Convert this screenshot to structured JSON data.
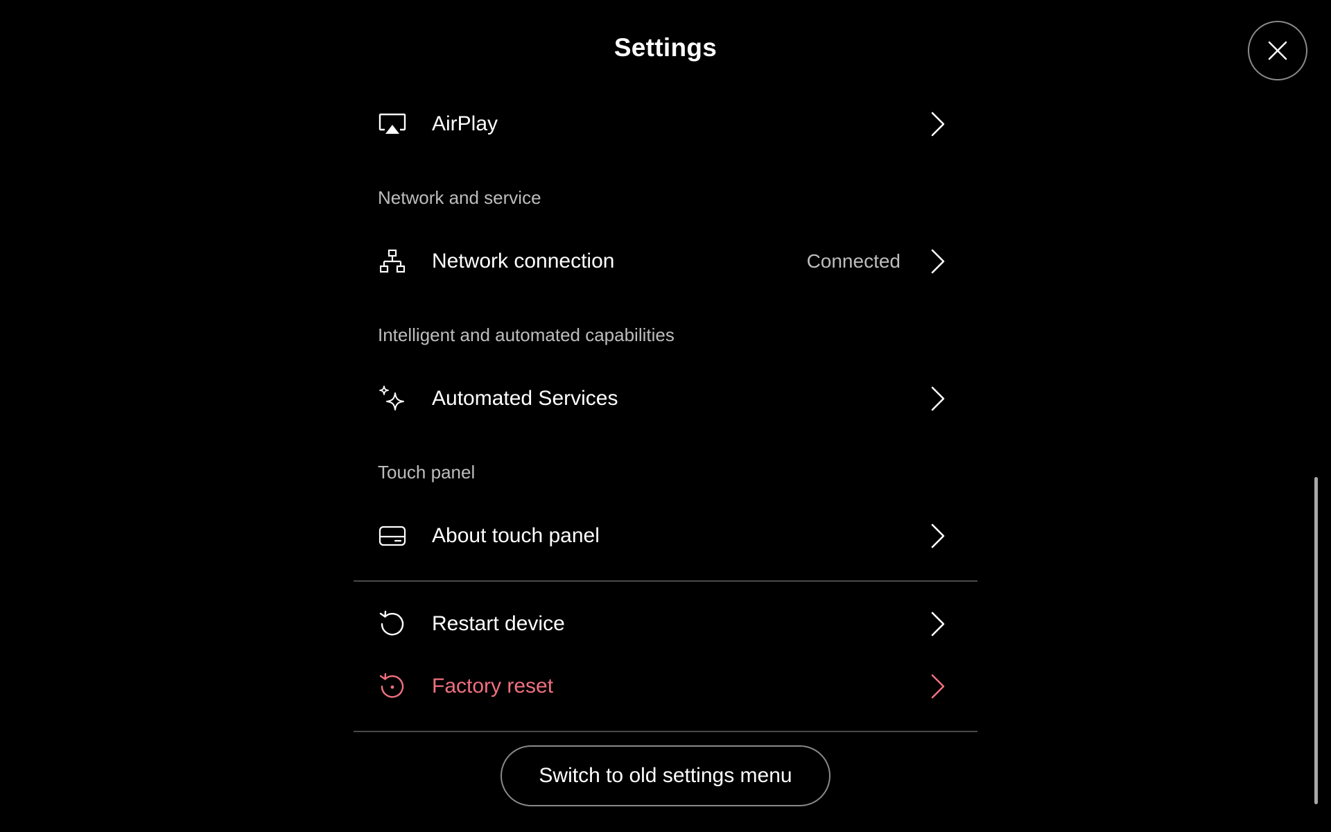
{
  "header": {
    "title": "Settings",
    "close_icon": "close-icon"
  },
  "items": {
    "airplay": {
      "label": "AirPlay",
      "icon": "airplay-icon"
    },
    "network_section": "Network and service",
    "network_connection": {
      "label": "Network connection",
      "status": "Connected",
      "icon": "network-icon"
    },
    "intelligent_section": "Intelligent and automated capabilities",
    "automated_services": {
      "label": "Automated Services",
      "icon": "sparkle-icon"
    },
    "touch_panel_section": "Touch panel",
    "about_touch_panel": {
      "label": "About touch panel",
      "icon": "touch-panel-icon"
    },
    "restart_device": {
      "label": "Restart device",
      "icon": "restart-icon"
    },
    "factory_reset": {
      "label": "Factory reset",
      "icon": "factory-reset-icon",
      "color": "#f0707f"
    }
  },
  "footer": {
    "switch_button": "Switch to old settings menu"
  },
  "colors": {
    "background": "#000000",
    "text": "#ffffff",
    "secondary_text": "#bdbdbd",
    "danger": "#f0707f",
    "divider": "#4a4a4a"
  }
}
